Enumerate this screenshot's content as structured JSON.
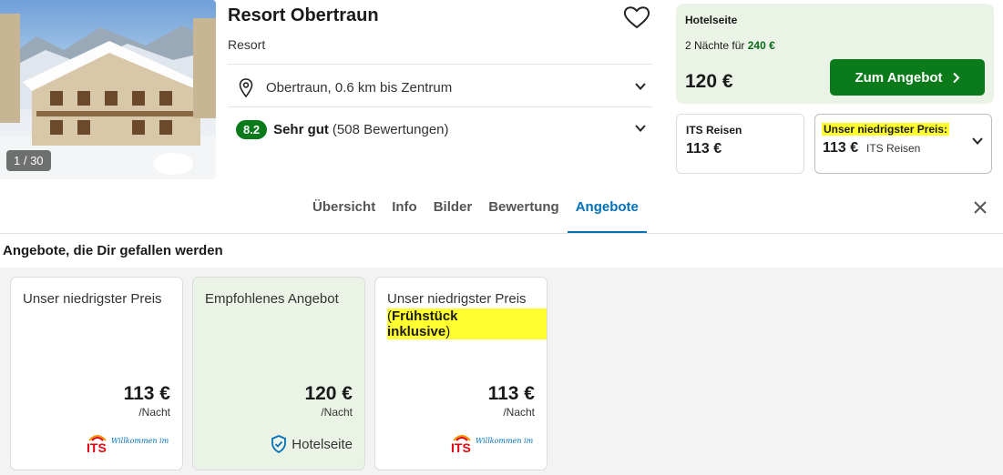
{
  "hotel": {
    "title": "Resort Obertraun",
    "type": "Resort",
    "photo_counter": "1 / 30",
    "location": "Obertraun, 0.6 km bis Zentrum",
    "rating_score": "8.2",
    "rating_label": "Sehr gut",
    "rating_count": "(508 Bewertungen)"
  },
  "deal": {
    "source": "Hotelseite",
    "nights_text": "2 Nächte für",
    "nights_price": "240 €",
    "price": "120 €",
    "button_label": "Zum Angebot"
  },
  "alt_offer": {
    "name": "ITS Reisen",
    "price": "113 €"
  },
  "lowest_offer": {
    "label": "Unser niedrigster Preis:",
    "price": "113 €",
    "provider": "ITS Reisen"
  },
  "tabs": [
    {
      "label": "Übersicht",
      "active": false
    },
    {
      "label": "Info",
      "active": false
    },
    {
      "label": "Bilder",
      "active": false
    },
    {
      "label": "Bewertung",
      "active": false
    },
    {
      "label": "Angebote",
      "active": true
    }
  ],
  "offers": {
    "section_title": "Angebote, die Dir gefallen werden",
    "cards": [
      {
        "heading": "Unser niedrigster Preis",
        "sub": "",
        "price": "113 €",
        "per": "/Nacht",
        "provider": "ITS"
      },
      {
        "heading": "Empfohlenes Angebot",
        "sub": "",
        "price": "120 €",
        "per": "/Nacht",
        "provider": "Hotelseite"
      },
      {
        "heading": "Unser niedrigster Preis",
        "sub": "Frühstück inklusive",
        "price": "113 €",
        "per": "/Nacht",
        "provider": "ITS"
      }
    ],
    "its_logo_text": "ITS",
    "its_slogan": "Willkommen im Urlaub!"
  },
  "colors": {
    "green": "#0a7a1a",
    "blue": "#0070b8",
    "highlight": "#ffff30"
  }
}
